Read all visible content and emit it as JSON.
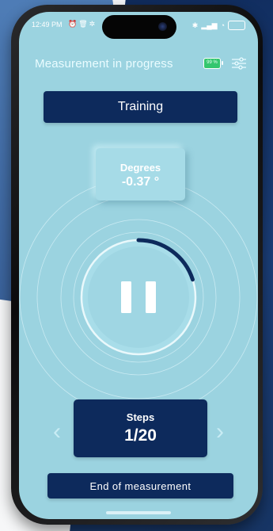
{
  "status_bar": {
    "time": "12:49 PM",
    "left_icons": [
      "alarm-icon",
      "trash-icon",
      "gear-icon"
    ],
    "right_icons": [
      "bluetooth-icon",
      "signal-icon",
      "wifi-icon",
      "battery-icon"
    ]
  },
  "header": {
    "title": "Measurement in progress",
    "battery_label": "99 %"
  },
  "training_label": "Training",
  "degrees": {
    "label": "Degrees",
    "value": "-0.37 °"
  },
  "progress": {
    "fraction": 0.2,
    "state_icon": "pause-icon"
  },
  "steps": {
    "label": "Steps",
    "value": "1/20"
  },
  "end_button_label": "End of measurement",
  "colors": {
    "screen_bg": "#9bd3e0",
    "button_dark": "#0d2a5c",
    "progress_arc": "#0d2a5c",
    "battery_green": "#34c66e"
  }
}
